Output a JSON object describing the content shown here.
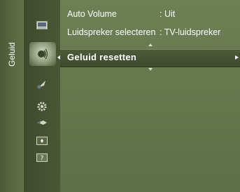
{
  "category": {
    "label": "Geluid"
  },
  "icons": [
    "picture-icon",
    "sound-icon",
    "channel-icon",
    "setup-icon",
    "input-icon",
    "application-icon",
    "support-icon"
  ],
  "menu": {
    "rows": [
      {
        "label": "Auto Volume",
        "value": ": Uit"
      },
      {
        "label": "Luidspreker selecteren",
        "value": ": TV-luidspreker"
      }
    ],
    "selected": {
      "label": "Geluid resetten"
    }
  },
  "colors": {
    "accent": "#4e5b38",
    "background": "#5f6f47",
    "text": "#ffffff"
  }
}
